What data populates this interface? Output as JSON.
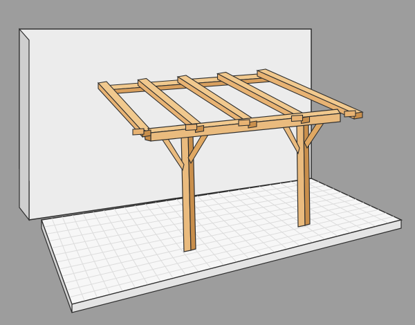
{
  "scene": {
    "subject": "wall-mounted-timber-pergola",
    "rafter_count": 5,
    "post_count": 2,
    "brace_count": 4,
    "colors": {
      "background": "#9d9d9d",
      "wall": "#ececec",
      "wall_edge": "#bdbdbd",
      "floor_top": "#f7f7f7",
      "floor_grid": "#dcdcdc",
      "floor_front": "#e4e4e4",
      "floor_side": "#d2d2d2",
      "wood_light": "#f1c98e",
      "wood_mid": "#e8b373",
      "wood_dark": "#c98f4c",
      "outline": "#2e2e2e"
    }
  }
}
